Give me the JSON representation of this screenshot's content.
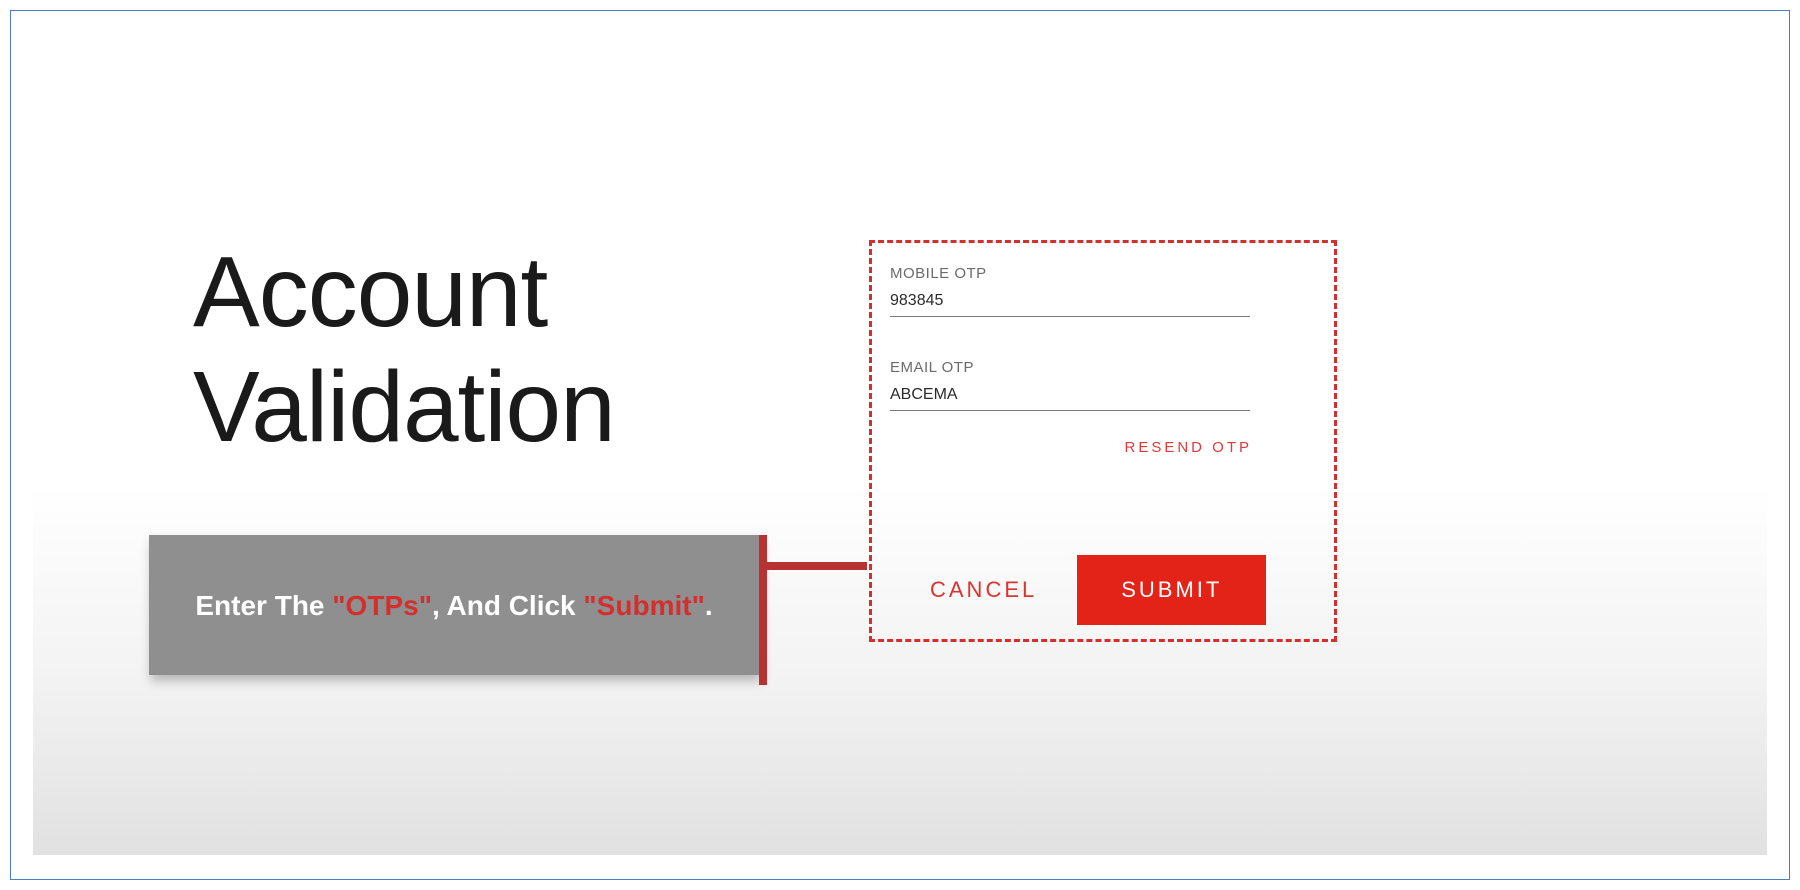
{
  "title": "Account\nValidation",
  "callout": {
    "pre": "Enter The ",
    "hl1": "\"OTPs\"",
    "mid": ", And Click ",
    "hl2": "\"Submit\"",
    "post": "."
  },
  "form": {
    "mobile": {
      "label": "MOBILE OTP",
      "value": "983845"
    },
    "email": {
      "label": "EMAIL OTP",
      "value": "ABCEMA"
    },
    "resend_label": "RESEND OTP",
    "cancel_label": "CANCEL",
    "submit_label": "SUBMIT"
  }
}
